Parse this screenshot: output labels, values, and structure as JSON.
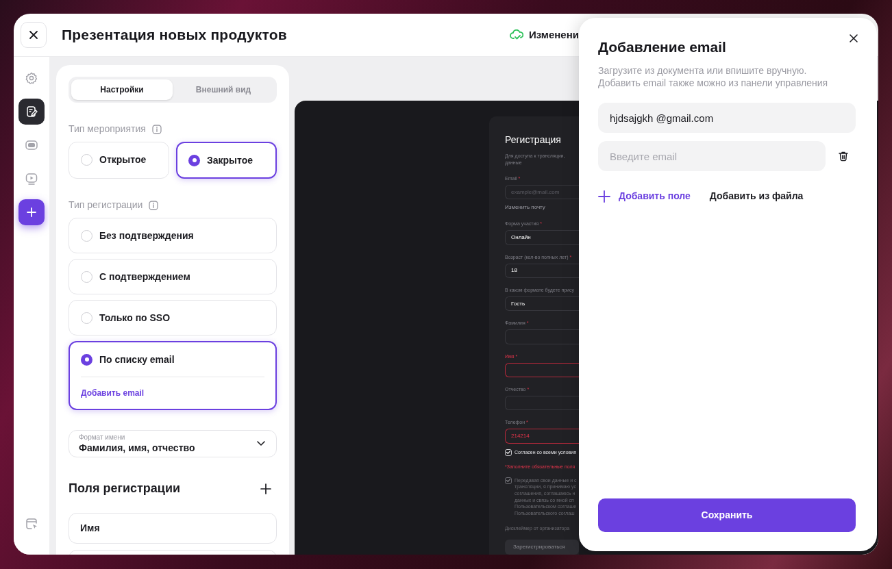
{
  "header": {
    "title": "Презентация новых продуктов",
    "status": "Изменени"
  },
  "rail": {
    "items": [
      {
        "kind": "gear",
        "selected": false
      },
      {
        "kind": "note",
        "selected": true
      },
      {
        "kind": "screen",
        "selected": false
      },
      {
        "kind": "play",
        "selected": false
      },
      {
        "kind": "plus"
      }
    ],
    "bottom": {
      "kind": "exit"
    }
  },
  "settings": {
    "tabs": [
      {
        "label": "Настройки",
        "selected": true
      },
      {
        "label": "Внешний вид",
        "selected": false
      }
    ],
    "event_type": {
      "label": "Тип мероприятия",
      "options": [
        {
          "label": "Открытое",
          "selected": false
        },
        {
          "label": "Закрытое",
          "selected": true
        }
      ]
    },
    "registration_type": {
      "label": "Тип регистрации",
      "options": [
        {
          "label": "Без подтверждения",
          "selected": false
        },
        {
          "label": "С подтверждением",
          "selected": false
        },
        {
          "label": "Только по SSO",
          "selected": false
        },
        {
          "label": "По списку email",
          "selected": true,
          "link": "Добавить email"
        }
      ]
    },
    "name_format": {
      "label": "Формат имени",
      "value": "Фамилия, имя, отчество"
    },
    "fields_section": {
      "title": "Поля регистрации",
      "fields": [
        "Имя"
      ]
    }
  },
  "preview": {
    "title": "Регистрация",
    "subtitle": [
      "Для доступа к трансляции,",
      "данные"
    ],
    "fields": [
      {
        "label": "Email",
        "mark": "*",
        "placeholder": "example@mail.com",
        "error": false,
        "label_error": false,
        "link": "Изменить почту"
      },
      {
        "label": "Форма участия",
        "mark": "*",
        "value": "Онлайн",
        "error": false,
        "label_error": false
      },
      {
        "label": "Возраст (кол-во полных лет)",
        "mark": "*",
        "value": "18",
        "error": false,
        "label_error": false
      },
      {
        "label": "В каком формате будете прису",
        "value": "Гость",
        "error": false,
        "label_error": false
      },
      {
        "label": "Фамилия",
        "mark": "*",
        "error": false,
        "label_error": false
      },
      {
        "label": "Имя",
        "mark": "*",
        "error": true,
        "label_error": true
      },
      {
        "label": "Отчество",
        "mark": "*",
        "error": false,
        "label_error": false
      },
      {
        "label": "Телефон",
        "mark": "*",
        "value": "214214",
        "error": true,
        "label_error": false
      }
    ],
    "agree": {
      "label": "Согласен со всеми условия",
      "checked": true
    },
    "error_text": "*Заполните обязательные поля",
    "consent": {
      "checked": true,
      "lines": [
        "Передавая свои данные и с",
        "трансляции, я принимаю ус",
        "соглашения, соглашаюсь н",
        "данных и связь со мной сп",
        "Пользовательском соглаше",
        "Пользовательского соглаш"
      ]
    },
    "disclaimer": "Дисклеймер от организатора",
    "button": "Зарегистрироваться"
  },
  "modal": {
    "title": "Добавление email",
    "description": [
      "Загрузите из документа или впишите вручную.",
      "Добавить email также можно из панели управления"
    ],
    "emails": [
      {
        "value": "hjdsajgkh @gmail.com",
        "removable": false
      },
      {
        "placeholder": "Введите email",
        "removable": true
      }
    ],
    "add_field": "Добавить поле",
    "add_from_file": "Добавить из файла",
    "save": "Сохранить"
  }
}
